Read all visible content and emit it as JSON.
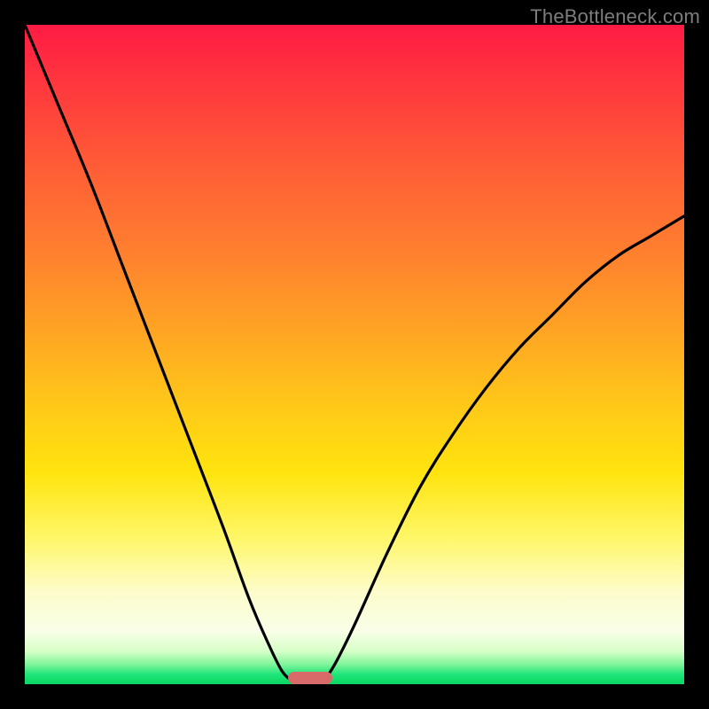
{
  "watermark": "TheBottleneck.com",
  "chart_data": {
    "type": "line",
    "title": "",
    "xlabel": "",
    "ylabel": "",
    "xlim": [
      0,
      100
    ],
    "ylim": [
      0,
      100
    ],
    "grid": false,
    "legend": false,
    "series": [
      {
        "name": "left-curve",
        "x": [
          0,
          5,
          10,
          15,
          20,
          25,
          30,
          34,
          37,
          39,
          40.5,
          41.5
        ],
        "y": [
          100,
          88,
          76,
          63,
          50,
          37,
          24,
          13,
          6,
          2,
          0.5,
          0
        ]
      },
      {
        "name": "right-curve",
        "x": [
          45,
          47,
          50,
          55,
          60,
          65,
          70,
          75,
          80,
          85,
          90,
          95,
          100
        ],
        "y": [
          0,
          3,
          9,
          20,
          30,
          38,
          45,
          51,
          56,
          61,
          65,
          68,
          71
        ]
      }
    ],
    "marker": {
      "x_center": 43.3,
      "y": 0,
      "width_pct": 6.7,
      "color": "#d86a6a"
    },
    "background_gradient": {
      "top": "#ff1b44",
      "mid": "#ffd21a",
      "bottom": "#0ad763"
    }
  }
}
